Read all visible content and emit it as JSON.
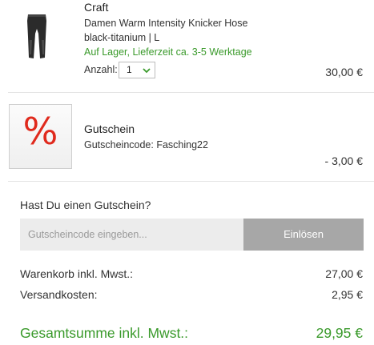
{
  "product": {
    "brand": "Craft",
    "name": "Damen Warm Intensity Knicker Hose",
    "variant": "black-titanium | L",
    "stock": "Auf Lager, Lieferzeit ca. 3-5 Werktage",
    "quantity_label": "Anzahl:",
    "quantity_value": "1",
    "price": "30,00 €",
    "image_icon": "leggings-image"
  },
  "voucher": {
    "symbol": "%",
    "title": "Gutschein",
    "code_line": "Gutscheincode: Fasching22",
    "price": "- 3,00 €"
  },
  "coupon": {
    "question": "Hast Du einen Gutschein?",
    "placeholder": "Gutscheincode eingeben...",
    "button_label": "Einlösen"
  },
  "totals": {
    "cart_label": "Warenkorb inkl. Mwst.:",
    "cart_value": "27,00 €",
    "shipping_label": "Versandkosten:",
    "shipping_value": "2,95 €",
    "grand_label": "Gesamtsumme inkl. Mwst.:",
    "grand_value": "29,95 €"
  },
  "colors": {
    "accent_green": "#3a9a2b",
    "percent_red": "#e02a1d",
    "button_gray": "#a7a7a7"
  }
}
